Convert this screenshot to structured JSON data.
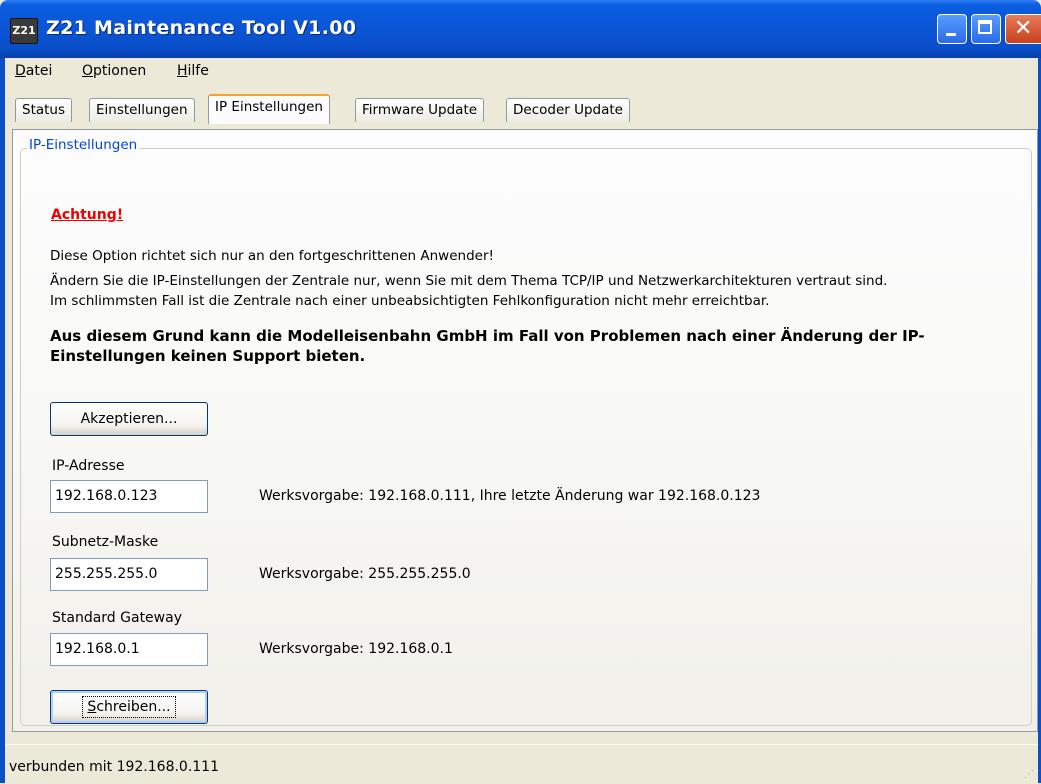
{
  "window": {
    "title": "Z21 Maintenance Tool V1.00",
    "icon_label": "Z21"
  },
  "menu": [
    {
      "mnemonic": "D",
      "rest": "atei"
    },
    {
      "mnemonic": "O",
      "rest": "ptionen"
    },
    {
      "mnemonic": "H",
      "rest": "ilfe"
    }
  ],
  "tabs": [
    "Status",
    "Einstellungen",
    "IP Einstellungen",
    "Firmware Update",
    "Decoder Update"
  ],
  "active_tab": "IP Einstellungen",
  "group": {
    "legend": "IP-Einstellungen",
    "warning_title": "Achtung!",
    "line1": "Diese Option richtet sich nur an den fortgeschrittenen Anwender!",
    "line2": "Ändern Sie die IP-Einstellungen der Zentrale nur, wenn Sie mit dem Thema TCP/IP und Netzwerkarchitekturen vertraut sind.",
    "line3": "Im schlimmsten Fall ist die Zentrale nach einer unbeabsichtigten Fehlkonfiguration nicht mehr erreichtbar.",
    "bold_warning": "Aus diesem Grund kann die Modelleisenbahn GmbH im Fall von Problemen nach einer Änderung der IP-Einstellungen keinen Support bieten.",
    "accept_button": "Akzeptieren...",
    "ip_label": "IP-Adresse",
    "ip_value": "192.168.0.123",
    "ip_hint": "Werksvorgabe: 192.168.0.111, Ihre letzte Änderung war 192.168.0.123",
    "subnet_label": "Subnetz-Maske",
    "subnet_value": "255.255.255.0",
    "subnet_hint": "Werksvorgabe: 255.255.255.0",
    "gateway_label": "Standard Gateway",
    "gateway_value": "192.168.0.1",
    "gateway_hint": "Werksvorgabe: 192.168.0.1",
    "write_button_mnemonic": "S",
    "write_button_rest": "chreiben..."
  },
  "status": "verbunden mit 192.168.0.111",
  "colors": {
    "titlebar": "#0a4ec8",
    "warning": "#e00000",
    "legend": "#0046d5",
    "active_tab_accent": "#f6a32b"
  }
}
